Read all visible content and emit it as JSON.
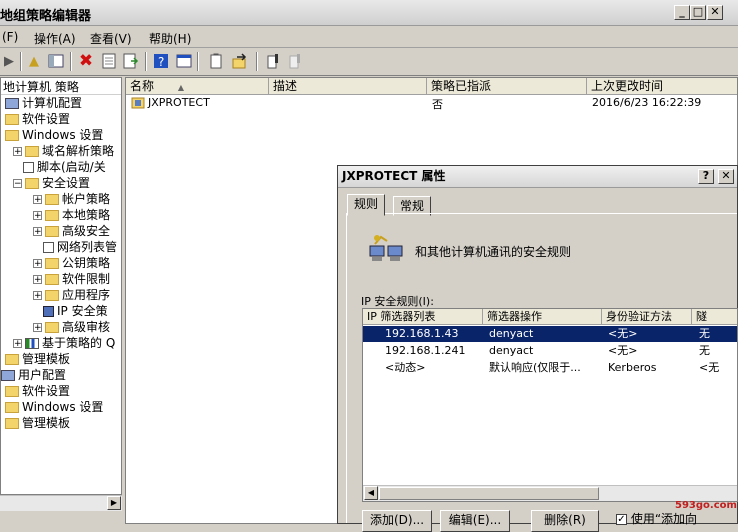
{
  "window": {
    "title": "地组策略编辑器"
  },
  "menu": [
    "(F)",
    "操作(A)",
    "查看(V)",
    "帮助(H)"
  ],
  "tree": {
    "header": "地计算机 策略",
    "items": [
      {
        "label": "计算机配置",
        "icon": "computer-icon"
      },
      {
        "label": "软件设置",
        "icon": "folder-icon"
      },
      {
        "label": "Windows 设置",
        "icon": "folder-icon"
      },
      {
        "label": "域名解析策略",
        "icon": "folder-icon"
      },
      {
        "label": "脚本(启动/关",
        "icon": "script-icon"
      },
      {
        "label": "安全设置",
        "icon": "shield-folder-icon"
      },
      {
        "label": "帐户策略",
        "icon": "folder-icon"
      },
      {
        "label": "本地策略",
        "icon": "folder-icon"
      },
      {
        "label": "高级安全",
        "icon": "folder-icon"
      },
      {
        "label": "网络列表管",
        "icon": "list-icon"
      },
      {
        "label": "公钥策略",
        "icon": "folder-icon"
      },
      {
        "label": "软件限制",
        "icon": "folder-icon"
      },
      {
        "label": "应用程序",
        "icon": "folder-icon"
      },
      {
        "label": "IP 安全策",
        "icon": "ip-security-icon"
      },
      {
        "label": "高级审核",
        "icon": "folder-icon"
      },
      {
        "label": "基于策略的 Q",
        "icon": "chart-icon"
      },
      {
        "label": "管理模板",
        "icon": "folder-icon"
      },
      {
        "label": "用户配置",
        "icon": "user-icon"
      },
      {
        "label": "软件设置",
        "icon": "folder-icon"
      },
      {
        "label": "Windows 设置",
        "icon": "folder-icon"
      },
      {
        "label": "管理模板",
        "icon": "folder-icon"
      }
    ]
  },
  "list": {
    "columns": [
      "名称",
      "描述",
      "策略已指派",
      "上次更改时间"
    ],
    "rows": [
      {
        "name": "JXPROTECT",
        "desc": "",
        "assigned": "否",
        "modified": "2016/6/23 16:22:39"
      }
    ]
  },
  "dialog": {
    "title": "JXPROTECT 属性",
    "tabs": [
      "规则",
      "常规"
    ],
    "description": "和其他计算机通讯的安全规则",
    "rules_label": "IP 安全规则(I):",
    "rule_columns": [
      "IP 筛选器列表",
      "筛选器操作",
      "身份验证方法",
      "隧"
    ],
    "rules": [
      {
        "checked": true,
        "filter": "192.168.1.43",
        "action": "denyact",
        "auth": "<无>",
        "tunnel": "无"
      },
      {
        "checked": true,
        "filter": "192.168.1.241",
        "action": "denyact",
        "auth": "<无>",
        "tunnel": "无"
      },
      {
        "checked": false,
        "filter": "<动态>",
        "action": "默认响应(仅限于...",
        "auth": "Kerberos",
        "tunnel": "<无"
      }
    ],
    "buttons": {
      "add": "添加(D)...",
      "edit": "编辑(E)...",
      "remove": "删除(R)",
      "use_wizard": "使用“添加向"
    }
  },
  "watermark": "593go.com"
}
